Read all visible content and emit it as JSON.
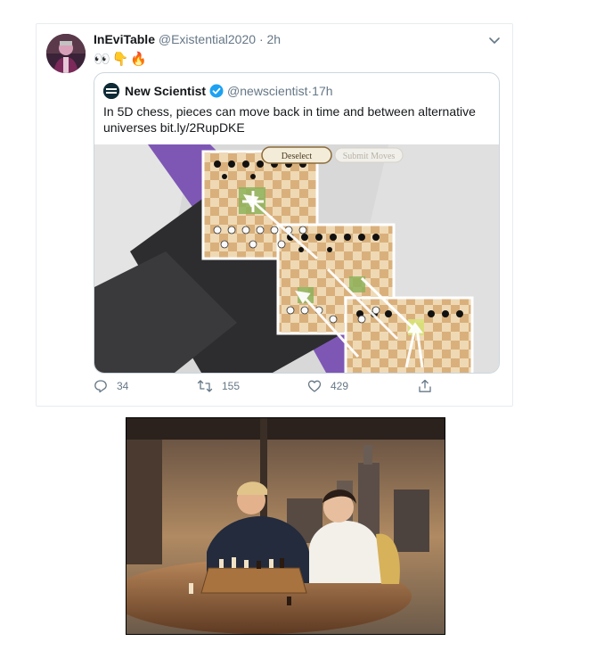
{
  "tweet": {
    "display_name": "InEviTable",
    "handle": "@Existential2020",
    "separator": "·",
    "time": "2h",
    "emojis": "👀👇🔥",
    "avatar_icon": "avatar-icon",
    "menu_icon": "chevron-down-icon"
  },
  "quote": {
    "display_name": "New Scientist",
    "handle": "@newscientist",
    "separator": "·",
    "time": "17h",
    "text": "In 5D chess, pieces can move back in time and between alternative universes bit.ly/2RupDKE",
    "image": {
      "deselect_label": "Deselect",
      "submit_label": "Submit Moves"
    }
  },
  "actions": {
    "reply_count": "34",
    "retweet_count": "155",
    "like_count": "429"
  },
  "colors": {
    "brand_blue": "#1da1f2",
    "text_secondary": "#657786",
    "board_light": "#efd9b4",
    "board_dark": "#d9b07c",
    "board_highlight": "#8db35c",
    "purple_band": "#7e57b5"
  }
}
